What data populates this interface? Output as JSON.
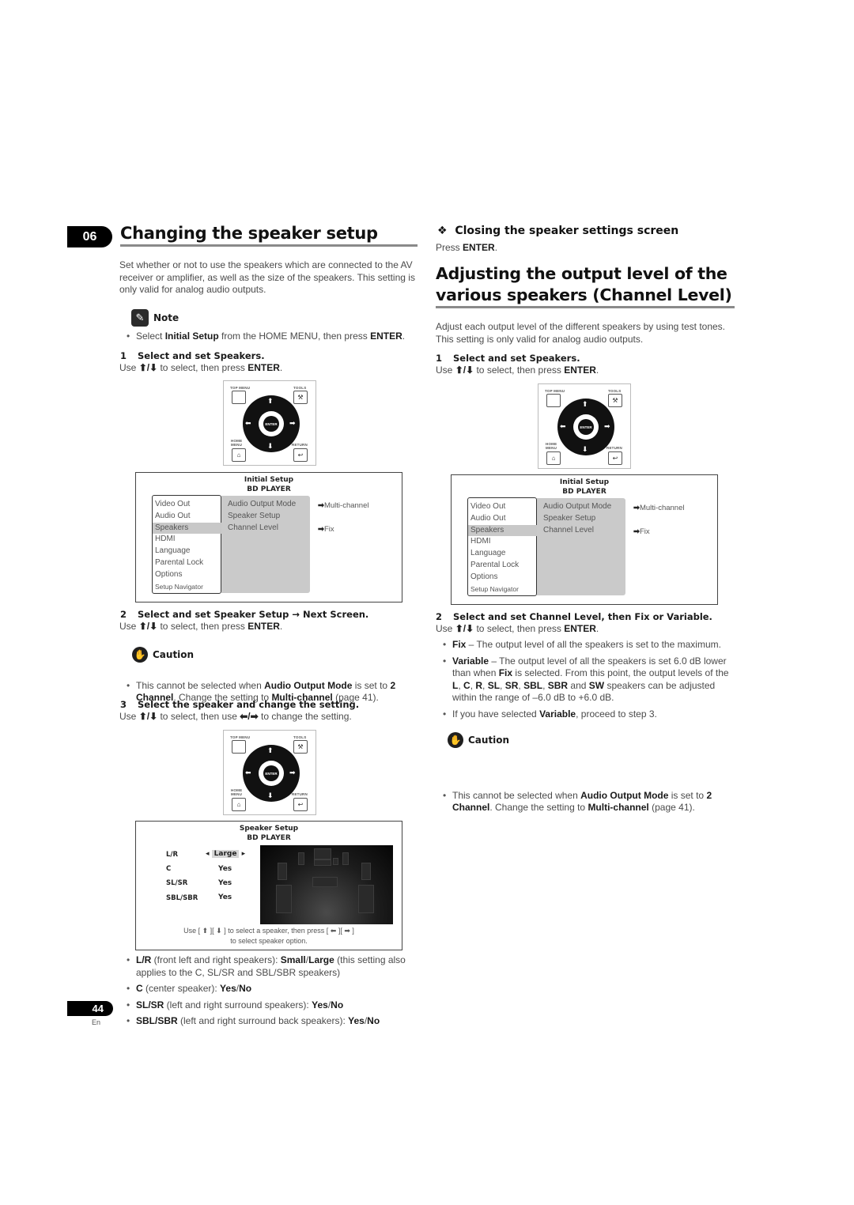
{
  "chapter": {
    "number": "06",
    "title": "Changing the speaker setup"
  },
  "intro": "Set whether or not to use the speakers which are connected to the AV receiver or amplifier, as well as the size of the speakers. This setting is only valid for analog audio outputs.",
  "note": {
    "title": "Note",
    "icon": "pencil-icon",
    "bullet": {
      "pre": "Select ",
      "b1": "Initial Setup",
      "mid": " from the HOME MENU, then press ",
      "b2": "ENTER",
      "post": "."
    }
  },
  "left_steps": {
    "step1": {
      "num": "1",
      "title": "Select and set Speakers.",
      "use": "Use",
      "updown": "⬆/⬇",
      "rest": " to select, then press ",
      "enter": "ENTER",
      "end": "."
    },
    "step2": {
      "num": "2",
      "title_a": "Select and set Speaker Setup",
      "arrow": "→",
      "title_b": "Next Screen.",
      "use": "Use",
      "updown": "⬆/⬇",
      "rest": " to select, then press ",
      "enter": "ENTER",
      "end": "."
    },
    "caution": {
      "title": "Caution",
      "icon": "hand-stop-icon",
      "pre": "This cannot be selected when ",
      "b1": "Audio Output Mode",
      "mid": " is set to ",
      "b2": "2 Channel",
      "mid2": ". Change the setting to ",
      "b3": "Multi-channel",
      "post": " (page 41)."
    },
    "step3": {
      "num": "3",
      "title": "Select the speaker and change the setting.",
      "use": "Use",
      "updown": "⬆/⬇",
      "rest": " to select, then use ",
      "leftright": "⬅/➡",
      "end": " to change the setting."
    }
  },
  "remote": {
    "top_menu": "TOP MENU",
    "tools": "TOOLS",
    "home_menu_1": "HOME",
    "home_menu_2": "MENU",
    "return": "RETURN",
    "enter": "ENTER",
    "icons": {
      "tools": "wrench-icon",
      "home": "home-icon",
      "return": "return-icon",
      "up": "arrow-up-icon",
      "down": "arrow-down-icon",
      "left": "arrow-left-icon",
      "right": "arrow-right-icon"
    }
  },
  "initial_setup_screen": {
    "title": "Initial Setup",
    "subtitle": "BD PLAYER",
    "left_menu": [
      "Video Out",
      "Audio Out",
      "Speakers",
      "HDMI",
      "Language",
      "Parental Lock",
      "Options",
      "Setup Navigator"
    ],
    "selected_index": 2,
    "mid_menu": [
      "Audio Output Mode",
      "Speaker Setup",
      "Channel Level"
    ],
    "values": [
      {
        "arrow": "➡",
        "text": "Multi-channel"
      },
      {
        "arrow": "➡",
        "text": "Fix"
      }
    ]
  },
  "speaker_setup_screen": {
    "title": "Speaker Setup",
    "subtitle": "BD PLAYER",
    "rows": [
      {
        "label": "L/R",
        "value": "Large",
        "selected": true,
        "left_arrow": "◂",
        "right_arrow": "▸"
      },
      {
        "label": "C",
        "value": "Yes"
      },
      {
        "label": "SL/SR",
        "value": "Yes"
      },
      {
        "label": "SBL/SBR",
        "value": "Yes"
      }
    ],
    "hint_line1": "Use [  ⬆  ][  ⬇  ] to select a speaker, then press [  ⬅  ][  ➡  ]",
    "hint_line2": "to select speaker option."
  },
  "speaker_bullets": [
    {
      "b1": "L/R",
      "t1": " (front left and right speakers): ",
      "b2": "Small",
      "sep": "/",
      "b3": "Large",
      "t2": " (this setting also applies to the C, SL/SR and SBL/SBR speakers)"
    },
    {
      "b1": "C",
      "t1": " (center speaker): ",
      "b2": "Yes",
      "sep": "/",
      "b3": "No",
      "t2": ""
    },
    {
      "b1": "SL/SR",
      "t1": " (left and right surround speakers): ",
      "b2": "Yes",
      "sep": "/",
      "b3": "No",
      "t2": ""
    },
    {
      "b1": "SBL/SBR",
      "t1": " (left and right surround back speakers): ",
      "b2": "Yes",
      "sep": "/",
      "b3": "No",
      "t2": ""
    }
  ],
  "closing": {
    "symbol": "❖",
    "title": "Closing the speaker settings screen",
    "press": "Press ",
    "enter": "ENTER",
    "end": "."
  },
  "channel_level": {
    "heading_line1": "Adjusting the output level of the",
    "heading_line2": "various speakers (Channel Level)",
    "intro": "Adjust each output level of the different speakers by using test tones. This setting is only valid for analog audio outputs.",
    "step1": {
      "num": "1",
      "title": "Select and set Speakers.",
      "use": "Use",
      "updown": "⬆/⬇",
      "rest": " to select, then press ",
      "enter": "ENTER",
      "end": "."
    },
    "step2": {
      "num": "2",
      "title": "Select and set Channel Level, then Fix or Variable.",
      "use": "Use",
      "updown": "⬆/⬇",
      "rest": " to select, then press ",
      "enter": "ENTER",
      "end": "."
    },
    "bullets": {
      "fix": {
        "b": "Fix",
        "t": " – The output level of all the speakers is set to the maximum."
      },
      "variable": {
        "b": "Variable",
        "t1": " – The output level of all the speakers is set 6.0 dB lower than when ",
        "b2": "Fix",
        "t2": " is selected. From this point, the output levels of the ",
        "L": "L",
        "C": "C",
        "R": "R",
        "SL": "SL",
        "SR": "SR",
        "SBL": "SBL",
        "SBR": "SBR",
        "SW": "SW",
        "t3": " speakers can be adjusted within the range of –6.0 dB to +6.0 dB.",
        "and": " and "
      },
      "proceed": {
        "pre": "If you have selected ",
        "b": "Variable",
        "post": ", proceed to step 3."
      }
    },
    "caution": {
      "title": "Caution",
      "pre": "This cannot be selected when ",
      "b1": "Audio Output Mode",
      "mid": " is set to ",
      "b2": "2 Channel",
      "mid2": ". Change the setting to ",
      "b3": "Multi-channel",
      "post": " (page 41)."
    }
  },
  "footer": {
    "page": "44",
    "lang": "En"
  }
}
